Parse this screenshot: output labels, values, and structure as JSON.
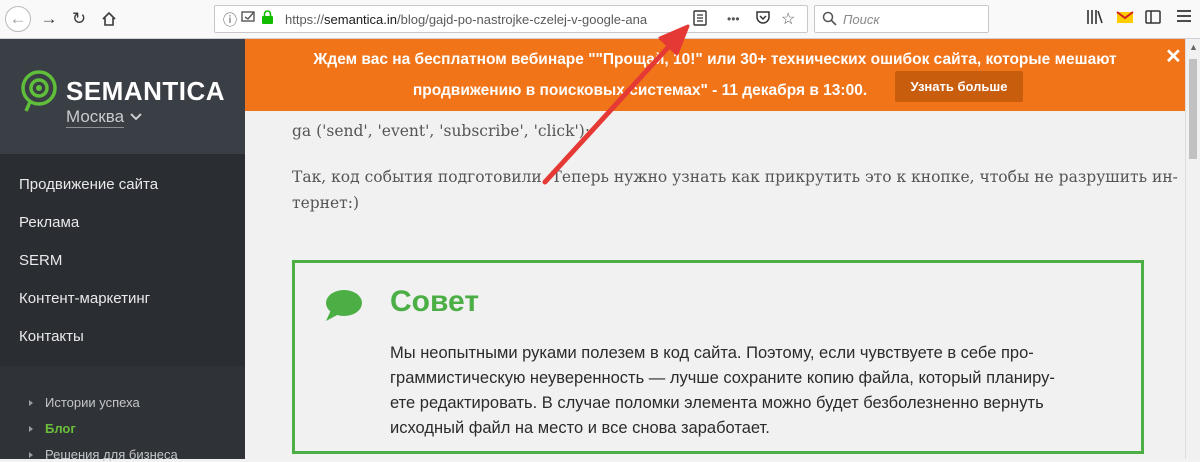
{
  "browser": {
    "url_scheme": "https://",
    "url_host": "semantica.in",
    "url_path": "/blog/gajd-po-nastrojke-czelej-v-google-ana",
    "search_placeholder": "Поиск",
    "more_glyph": "•••"
  },
  "sidebar": {
    "logo_text": "SEMANTICA",
    "city": "Москва",
    "menu": [
      {
        "label": "Продвижение сайта"
      },
      {
        "label": "Реклама"
      },
      {
        "label": "SERM"
      },
      {
        "label": "Контент-маркетинг"
      },
      {
        "label": "Контакты"
      }
    ],
    "submenu": [
      {
        "label": "Истории успеха",
        "active": false
      },
      {
        "label": "Блог",
        "active": true
      },
      {
        "label": "Решения для бизнеса",
        "active": false
      }
    ]
  },
  "banner": {
    "text": "Ждем вас на бесплатном вебинаре \"\"Прощай, 10!\" или 30+ технических ошибок сайта, которые мешают продвижению в поисковых системах\" - 11 декабря в 13:00.",
    "line1": "Ждем вас на бесплатном вебинаре \"\"Прощай, 10!\" или 30+ технических ошибок сайта, которые мешают",
    "line2": "продвижению в поисковых системах\" - 11 декабря в 13:00.",
    "button_label": "Узнать больше",
    "close_glyph": "✕"
  },
  "article": {
    "code_line": "ga ('send', 'event', 'subscribe', 'click');",
    "paragraph_line1": "Так, код события подготовили. Теперь нужно узнать как прикрутить это к кнопке, чтобы не разрушить ин-",
    "paragraph_line2": "тернет:)"
  },
  "tip": {
    "title": "Совет",
    "line1": "Мы неопытными руками полезем в код сайта. Поэтому, если чувствуете в себе про-",
    "line2": "граммистическую неуверенность — лучше сохраните копию файла, который планиру-",
    "line3": "ете редактировать. В случае поломки элемента можно будет безболезненно вернуть",
    "line4": "исходный файл на место и все снова заработает."
  },
  "colors": {
    "banner": "#f27419",
    "accent_green": "#4caf46",
    "sidebar": "#2f3237",
    "arrow": "#e53935"
  }
}
